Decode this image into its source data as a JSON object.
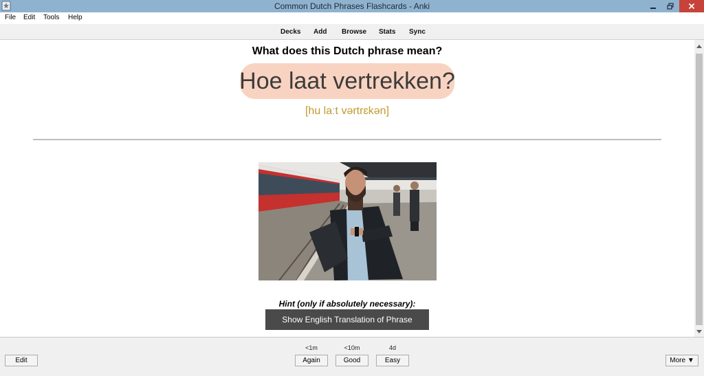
{
  "window": {
    "title": "Common Dutch Phrases Flashcards - Anki"
  },
  "menu": {
    "items": [
      "File",
      "Edit",
      "Tools",
      "Help"
    ]
  },
  "toolbar": {
    "links": [
      "Decks",
      "Add",
      "Browse",
      "Stats",
      "Sync"
    ]
  },
  "card": {
    "question": "What does this Dutch phrase mean?",
    "phrase": "Hoe laat vertrekken?",
    "pronunciation": "[hu laːt vərtrɛkən]",
    "hint_label": "Hint (only if absolutely necessary):",
    "hint_button": "Show English Translation of Phrase",
    "colors": {
      "phrase_background": "#f8d3c1",
      "pronunciation": "#c09a2f",
      "hint_button": "#4a4a4a"
    }
  },
  "bottom": {
    "edit_label": "Edit",
    "more_label": "More ▼",
    "answers": [
      {
        "label": "Again",
        "interval": "<1m"
      },
      {
        "label": "Good",
        "interval": "<10m"
      },
      {
        "label": "Easy",
        "interval": "4d"
      }
    ]
  }
}
